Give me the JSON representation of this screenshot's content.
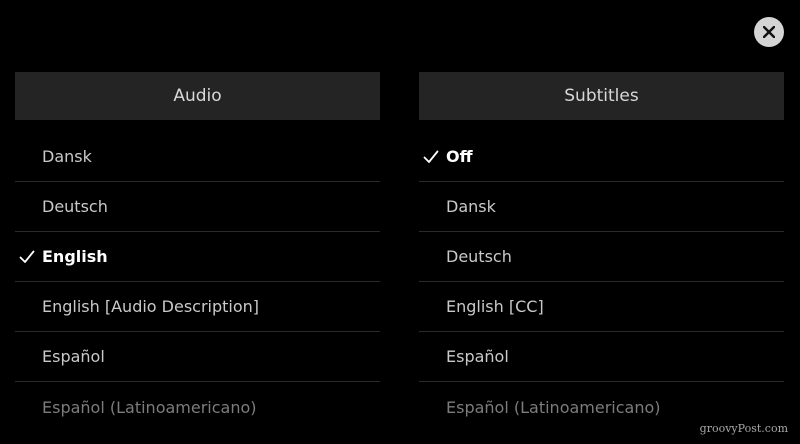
{
  "close": {
    "icon": "close-icon"
  },
  "audio": {
    "title": "Audio",
    "items": [
      {
        "label": "Dansk"
      },
      {
        "label": "Deutsch"
      },
      {
        "label": "English",
        "selected": true
      },
      {
        "label": "English [Audio Description]"
      },
      {
        "label": "Español"
      },
      {
        "label": "Español (Latinoamericano)"
      }
    ]
  },
  "subtitles": {
    "title": "Subtitles",
    "items": [
      {
        "label": "Off",
        "selected": true
      },
      {
        "label": "Dansk"
      },
      {
        "label": "Deutsch"
      },
      {
        "label": "English [CC]"
      },
      {
        "label": "Español"
      },
      {
        "label": "Español (Latinoamericano)"
      }
    ]
  },
  "watermark": "groovyPost.com",
  "colors": {
    "background": "#000000",
    "header": "#242424",
    "selected_text": "#ffffff",
    "text": "#c9c9c9",
    "faded_text": "#7c7c7c",
    "close_bg": "#d4d4d4"
  }
}
